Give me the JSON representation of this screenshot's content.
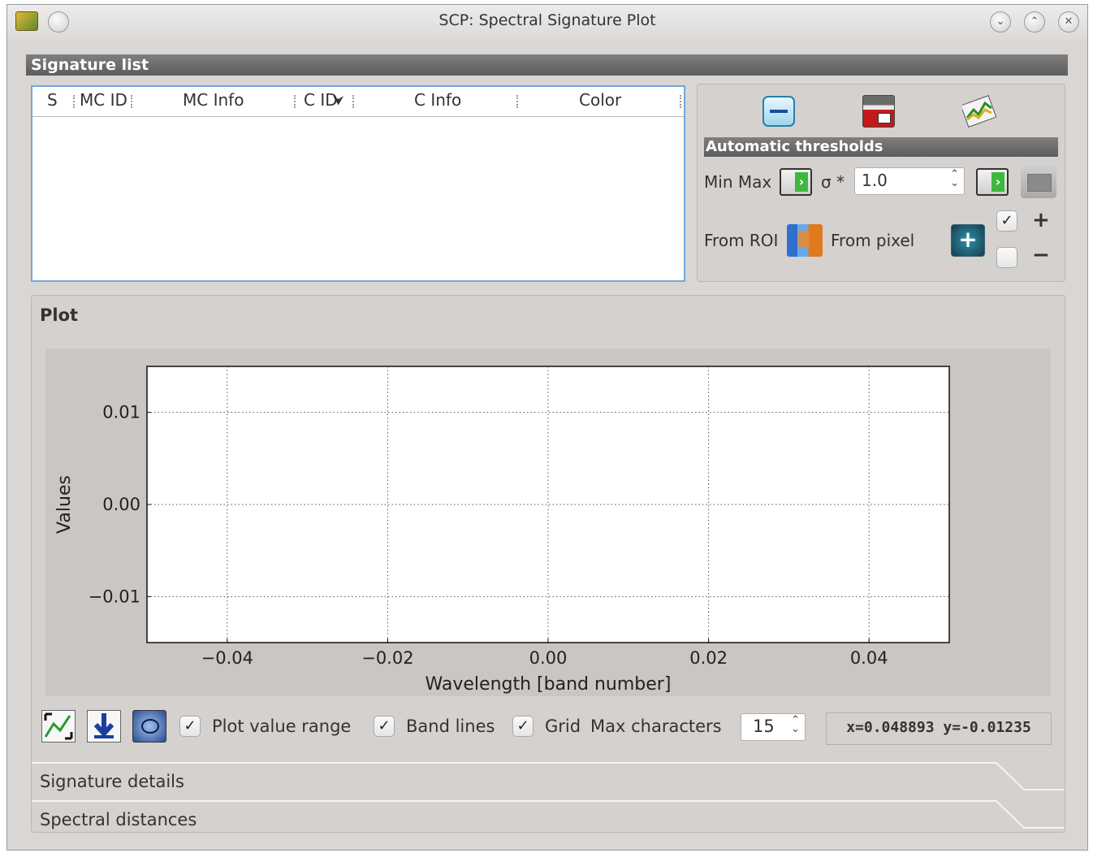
{
  "window": {
    "title": "SCP: Spectral Signature Plot"
  },
  "signature_list": {
    "header": "Signature list",
    "columns": [
      "S",
      "MC ID",
      "MC Info",
      "C ID",
      "C Info",
      "Color"
    ]
  },
  "tools": {
    "automatic_thresholds_header": "Automatic thresholds",
    "min_max_label": "Min Max",
    "sigma_label": "σ *",
    "sigma_value": "1.0",
    "from_roi_label": "From ROI",
    "from_pixel_label": "From pixel",
    "plus_symbol": "+",
    "minus_symbol": "−"
  },
  "plot": {
    "title": "Plot",
    "plot_value_range_label": "Plot value range",
    "band_lines_label": "Band lines",
    "grid_label": "Grid",
    "max_characters_label": "Max characters",
    "max_characters_value": "15",
    "coordinates": "x=0.048893 y=-0.01235"
  },
  "chart_data": {
    "type": "line",
    "xlabel": "Wavelength [band number]",
    "ylabel": "Values",
    "xlim": [
      -0.05,
      0.05
    ],
    "ylim": [
      0.015,
      -0.015
    ],
    "x_ticks": [
      "−0.04",
      "−0.02",
      "0.00",
      "0.02",
      "0.04"
    ],
    "y_ticks": [
      "−0.01",
      "0.00",
      "0.01"
    ],
    "grid": true,
    "series": []
  },
  "tabs": [
    "Signature details",
    "Spectral distances"
  ]
}
